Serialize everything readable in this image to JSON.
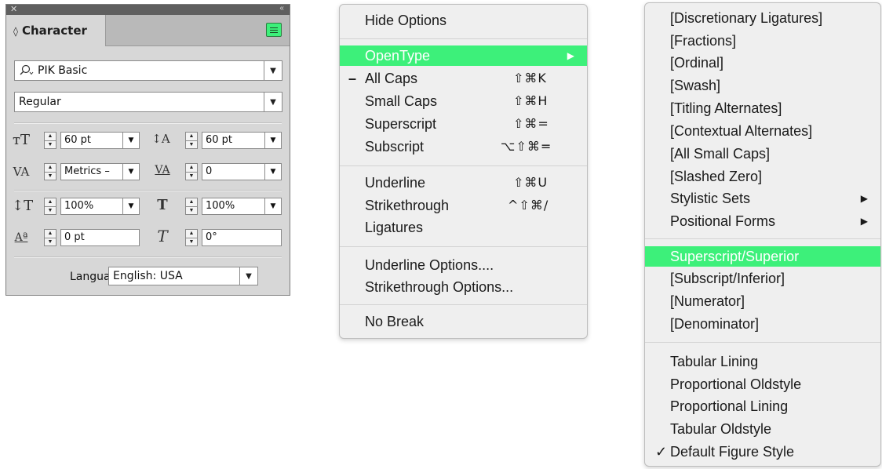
{
  "panel": {
    "tab_title": "Character",
    "font_family": "PIK Basic",
    "font_style": "Regular",
    "font_size": "60 pt",
    "leading": "60 pt",
    "kerning": "Metrics –",
    "tracking": "0",
    "vertical_scale": "100%",
    "horizontal_scale": "100%",
    "baseline_shift": "0 pt",
    "skew": "0°",
    "language_label": "Language:",
    "language": "English: USA",
    "accent_color": "#3df07a"
  },
  "menu1": {
    "items": {
      "hide_options": "Hide Options",
      "opentype": "OpenType",
      "all_caps": "All Caps",
      "all_caps_sc": "⇧⌘K",
      "all_caps_mark": "–",
      "small_caps": "Small Caps",
      "small_caps_sc": "⇧⌘H",
      "superscript": "Superscript",
      "superscript_sc": "⇧⌘=",
      "subscript": "Subscript",
      "subscript_sc": "⌥⇧⌘=",
      "underline": "Underline",
      "underline_sc": "⇧⌘U",
      "strikethrough": "Strikethrough",
      "strikethrough_sc": "^⇧⌘/",
      "ligatures": "Ligatures",
      "underline_options": "Underline Options....",
      "strikethrough_options": "Strikethrough Options...",
      "no_break": "No Break"
    }
  },
  "menu2": {
    "items": [
      "[Discretionary Ligatures]",
      "[Fractions]",
      "[Ordinal]",
      "[Swash]",
      "[Titling Alternates]",
      "[Contextual Alternates]",
      "[All Small Caps]",
      "[Slashed Zero]",
      "Stylistic Sets",
      "Positional Forms",
      "Superscript/Superior",
      "[Subscript/Inferior]",
      "[Numerator]",
      "[Denominator]",
      "Tabular Lining",
      "Proportional Oldstyle",
      "Proportional Lining",
      "Tabular Oldstyle",
      "Default Figure Style"
    ],
    "checked_mark": "✓"
  }
}
